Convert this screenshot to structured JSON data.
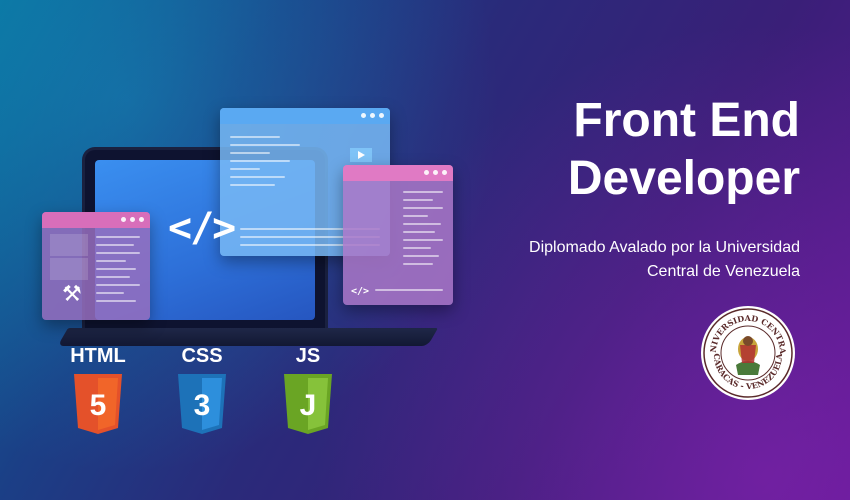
{
  "heading": {
    "line1": "Front End",
    "line2": "Developer"
  },
  "subtitle": {
    "line1": "Diplomado Avalado por la Universidad",
    "line2": "Central de Venezuela"
  },
  "illustration": {
    "code_symbol": "</>",
    "small_code_symbol": "</>",
    "tools_glyph": "⚒"
  },
  "technologies": [
    {
      "label": "HTML",
      "number": "5",
      "color": "#e4512a"
    },
    {
      "label": "CSS",
      "number": "3",
      "color": "#1d72b8"
    },
    {
      "label": "JS",
      "number": "J",
      "color": "#7ab62b"
    }
  ],
  "seal": {
    "text_top": "UNIVERSIDAD CENTRAL",
    "text_bottom": "CARACAS - VENEZUELA"
  },
  "colors": {
    "accent_blue": "#3a8ff0",
    "accent_pink": "#e07ac4"
  }
}
